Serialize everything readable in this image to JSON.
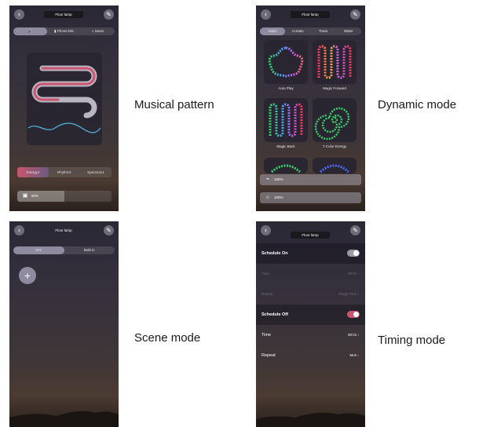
{
  "captions": {
    "musical": "Musical pattern",
    "dynamic": "Dynamic mode",
    "scene": "Scene mode",
    "timing": "Timing mode"
  },
  "header": {
    "title": "Floor lamp",
    "back_icon": "chevron-left-icon",
    "edit_icon": "pencil-icon"
  },
  "music_screen": {
    "tabs": [
      "Phone Mic",
      "Music"
    ],
    "active_tab_icon": "microphone-icon",
    "pills": [
      "Energy1",
      "Rhythm1",
      "Spectrum1"
    ],
    "brightness_value": "50%",
    "brightness_fraction": 0.5
  },
  "dynamic_screen": {
    "tabs": [
      "Static",
      "Curtain",
      "Trans",
      "Water"
    ],
    "tiles": [
      "Auto Play",
      "Magic Forward",
      "Magic Back",
      "7-Color Energy"
    ],
    "speed_value": "100%",
    "brightness_value": "100%"
  },
  "scene_screen": {
    "tabs": [
      "DIY",
      "Built-in"
    ],
    "add_icon": "plus-icon"
  },
  "timing_screen": {
    "schedule_on_label": "Schedule On",
    "on_time_label": "Time",
    "on_time_value": "00:01",
    "on_repeat_label": "Repeat",
    "on_repeat_value": "Single Time",
    "schedule_off_label": "Schedule Off",
    "off_time_label": "Time",
    "off_time_value": "00:01",
    "off_repeat_label": "Repeat",
    "off_repeat_value": "Mon"
  },
  "colors": {
    "accent": "#c9566e",
    "panel_bg": "#2a2631",
    "tab_active": "#8e8ba0"
  }
}
